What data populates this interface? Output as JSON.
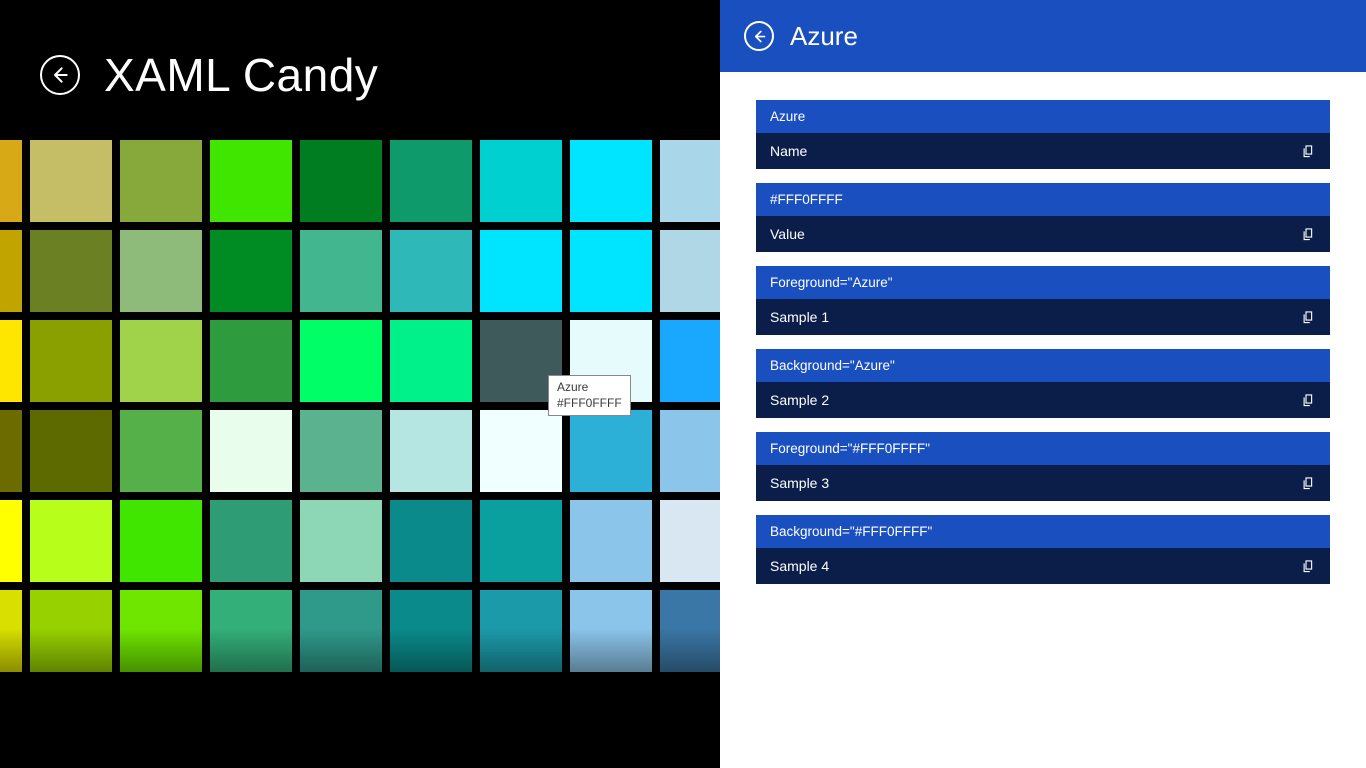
{
  "app": {
    "title": "XAML Candy"
  },
  "tooltip": {
    "name": "Azure",
    "hex": "#FFF0FFFF"
  },
  "detail": {
    "title": "Azure",
    "items": [
      {
        "top": "Azure",
        "bot": "Name"
      },
      {
        "top": "#FFF0FFFF",
        "bot": "Value"
      },
      {
        "top": "Foreground=\"Azure\"",
        "bot": "Sample 1"
      },
      {
        "top": "Background=\"Azure\"",
        "bot": "Sample 2"
      },
      {
        "top": "Foreground=\"#FFF0FFFF\"",
        "bot": "Sample 3"
      },
      {
        "top": "Background=\"#FFF0FFFF\"",
        "bot": "Sample 4"
      }
    ]
  },
  "swatches": [
    [
      "#d8a916",
      "#c6be67",
      "#87a83a",
      "#40e600",
      "#007c21",
      "#0f9a6c",
      "#00d0d0",
      "#00e5ff",
      "#a9d7e9"
    ],
    [
      "#c2a400",
      "#6b7f23",
      "#8fbb7a",
      "#008c23",
      "#42b68f",
      "#2fb8b8",
      "#00e5ff",
      "#00e5ff",
      "#b0d7e5"
    ],
    [
      "#ffe600",
      "#8aa000",
      "#a0d24a",
      "#2e9c3e",
      "#00ff66",
      "#00f08a",
      "#3f5a5a",
      "#e6fbfb",
      "#1aa8ff"
    ],
    [
      "#6b6b00",
      "#5d6a00",
      "#56b04a",
      "#e9fdec",
      "#5bb28f",
      "#b5e6e2",
      "#f0ffff",
      "#2db0d8",
      "#8cc5ea"
    ],
    [
      "#ffff00",
      "#b7ff1a",
      "#40e600",
      "#2e9c74",
      "#8dd6b6",
      "#0a8a8a",
      "#0aa0a0",
      "#8cc5ea",
      "#d8e7f2"
    ],
    [
      "#d9e000",
      "#97d100",
      "#6fe600",
      "#33b07a",
      "#2f9a8a",
      "#0a8a8a",
      "#1b9aa9",
      "#8cc5ea",
      "#3b77a6"
    ]
  ]
}
